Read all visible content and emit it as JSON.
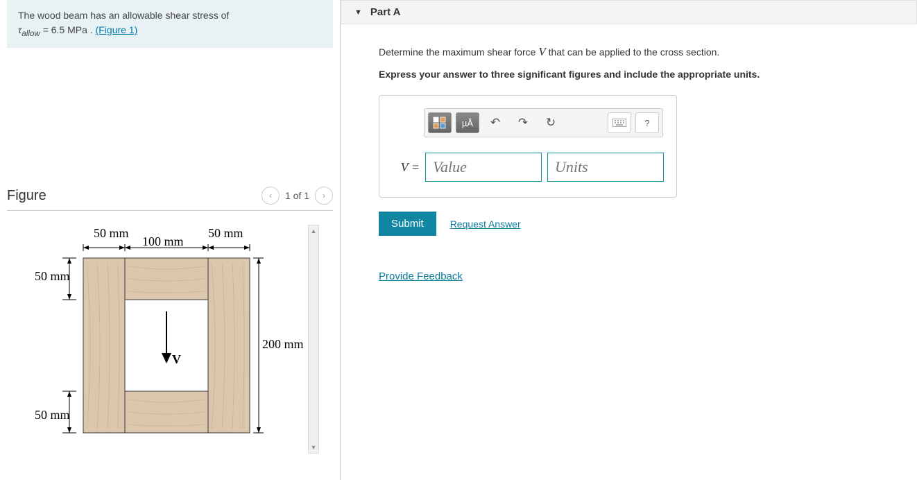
{
  "problem": {
    "text_prefix": "The wood beam has an allowable shear stress of",
    "tau_label": "τ",
    "tau_sub": "allow",
    "eq": " = 6.5 MPa . ",
    "figure_link": "(Figure 1)"
  },
  "figure": {
    "title": "Figure",
    "counter": "1 of 1",
    "dims": {
      "top_left": "50 mm",
      "top_right": "50 mm",
      "top_mid": "100 mm",
      "left_top": "50 mm",
      "left_bot": "50 mm",
      "right": "200 mm",
      "force": "V"
    }
  },
  "part": {
    "label": "Part A",
    "prompt_prefix": "Determine the maximum shear force ",
    "prompt_var": "V",
    "prompt_suffix": " that can be applied to the cross section.",
    "instruction": "Express your answer to three significant figures and include the appropriate units.",
    "toolbar": {
      "units_btn": "µÅ",
      "help_btn": "?"
    },
    "answer": {
      "label": "V = ",
      "value_placeholder": "Value",
      "units_placeholder": "Units"
    },
    "submit": "Submit",
    "request": "Request Answer"
  },
  "feedback": "Provide Feedback"
}
